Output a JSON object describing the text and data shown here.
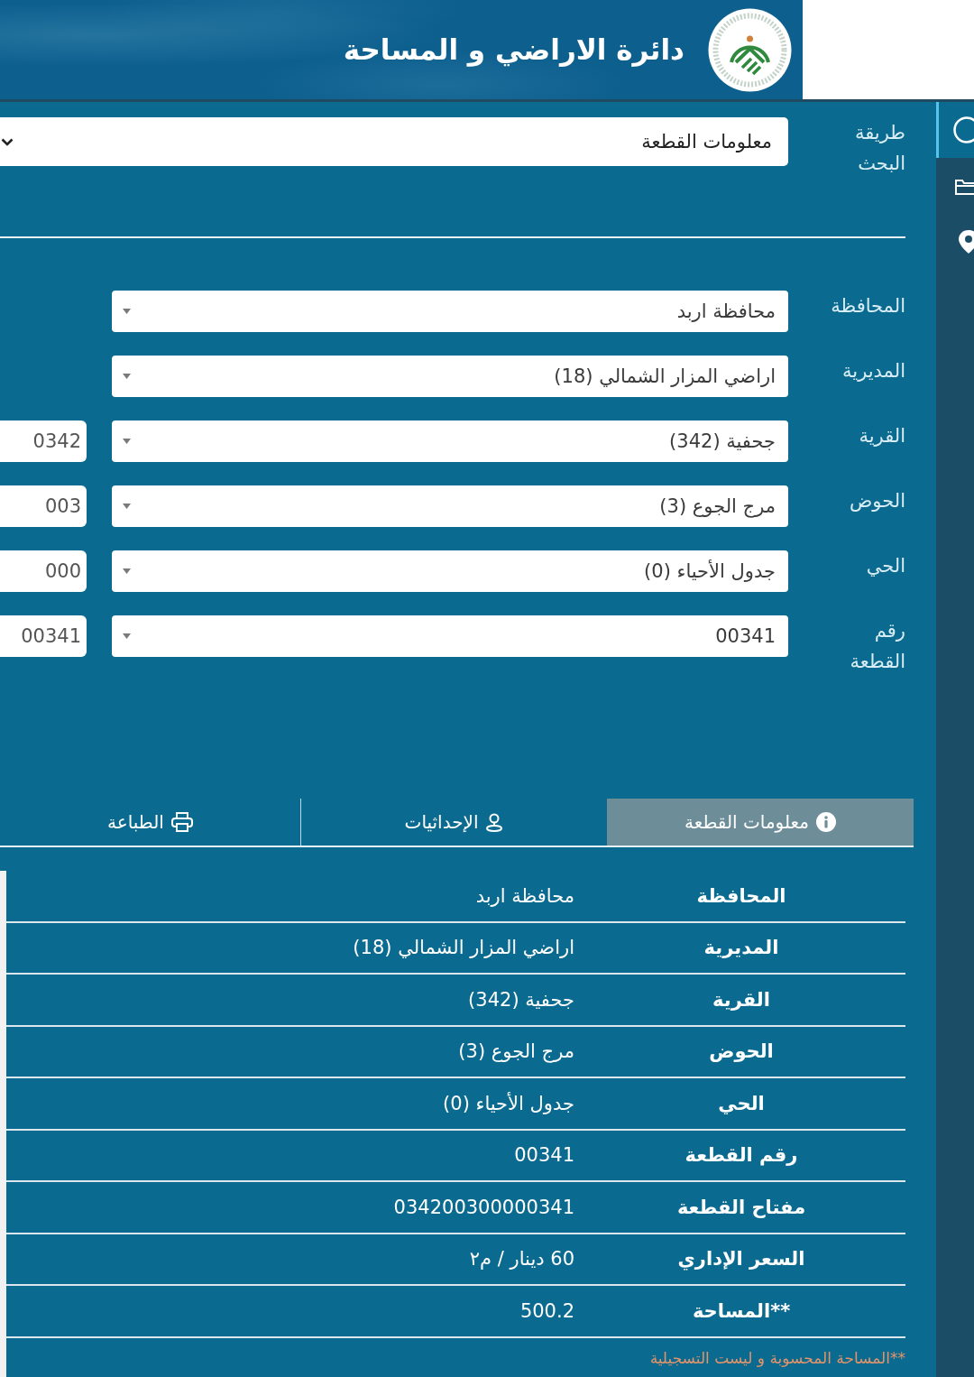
{
  "header": {
    "title": "دائرة الاراضي و المساحة"
  },
  "rail": [
    {
      "kind": "search",
      "selected": true
    },
    {
      "kind": "folder",
      "selected": false
    },
    {
      "kind": "pin",
      "selected": false
    }
  ],
  "search_method": {
    "label": "طريقة البحث",
    "value": "معلومات القطعة"
  },
  "fields": [
    {
      "label": "المحافظة",
      "value": "محافظة اربد"
    },
    {
      "label": "المديرية",
      "value": "اراضي المزار الشمالي (18)"
    },
    {
      "label": "القرية",
      "value": "جحفية (342)",
      "code": "0342"
    },
    {
      "label": "الحوض",
      "value": "مرج الجوع (3)",
      "code": "003"
    },
    {
      "label": "الحي",
      "value": "جدول الأحياء (0)",
      "code": "000"
    },
    {
      "label": "رقم القطعة",
      "value": "00341",
      "code": "00341"
    }
  ],
  "tabs": [
    {
      "label": "معلومات القطعة",
      "kind": "info",
      "selected": true
    },
    {
      "label": "الإحداثيات",
      "kind": "location",
      "selected": false
    },
    {
      "label": "الطباعة",
      "kind": "print",
      "selected": false
    }
  ],
  "details": [
    {
      "label": "المحافظة",
      "value": "محافظة اربد"
    },
    {
      "label": "المديرية",
      "value": "اراضي المزار الشمالي (18)"
    },
    {
      "label": "القرية",
      "value": "جحفية (342)"
    },
    {
      "label": "الحوض",
      "value": "مرج الجوع (3)"
    },
    {
      "label": "الحي",
      "value": "جدول الأحياء (0)"
    },
    {
      "label": "رقم القطعة",
      "value": "00341"
    },
    {
      "label": "مفتاح القطعة",
      "value": "034200300000341"
    },
    {
      "label": "السعر الإداري",
      "value": "60 دينار / م٢"
    },
    {
      "label": "**المساحة",
      "value": "500.2"
    }
  ],
  "footnote": "**المساحة المحسوبة و ليست التسجيلية"
}
